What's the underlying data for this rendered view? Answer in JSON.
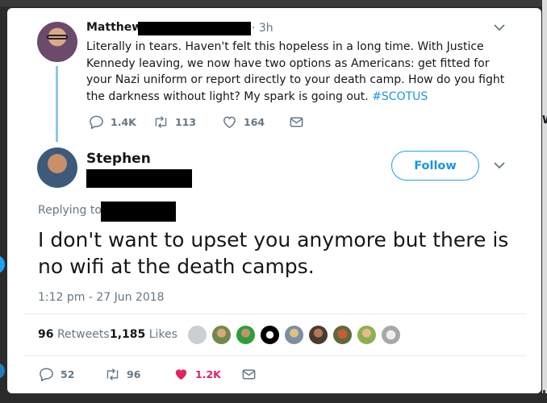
{
  "parent_tweet": {
    "author_name": "Matthew",
    "time": "· 3h",
    "text_before_hashtag": "Literally in tears. Haven't felt this hopeless in a long time. With Justice Kennedy leaving, we now have two options as Americans: get fitted for your Nazi uniform or report directly to your death camp. How do you fight the darkness without light? My spark is going out.",
    "hashtag": "#SCOTUS",
    "replies": "1.4K",
    "retweets": "113",
    "likes": "164"
  },
  "focused_tweet": {
    "author_name": "Stephen",
    "follow_label": "Follow",
    "replying_to_label": "Replying to",
    "text": "I don't want to upset you anymore but there is no wifi at the death camps.",
    "timestamp": "1:12 pm - 27 Jun 2018",
    "retweet_count": "96",
    "retweets_label": "Retweets",
    "like_count": "1,185",
    "likes_label": "Likes",
    "replies": "52",
    "retweets": "96",
    "likes": "1.2K"
  },
  "background": {
    "right_edge_fragments": [
      "W",
      "U"
    ]
  },
  "colors": {
    "accent": "#1da1f2",
    "link": "#1b95e0",
    "secondary_text": "#657786",
    "like_active": "#e0245e",
    "thread_line": "#8ec7e8"
  },
  "liker_avatars": [
    "gray-silhouette",
    "person-green-cap",
    "person-green-shirt",
    "pow-mia-logo",
    "person-blond",
    "person-bearded",
    "group-photo",
    "person-green-bg",
    "silver-coin"
  ]
}
